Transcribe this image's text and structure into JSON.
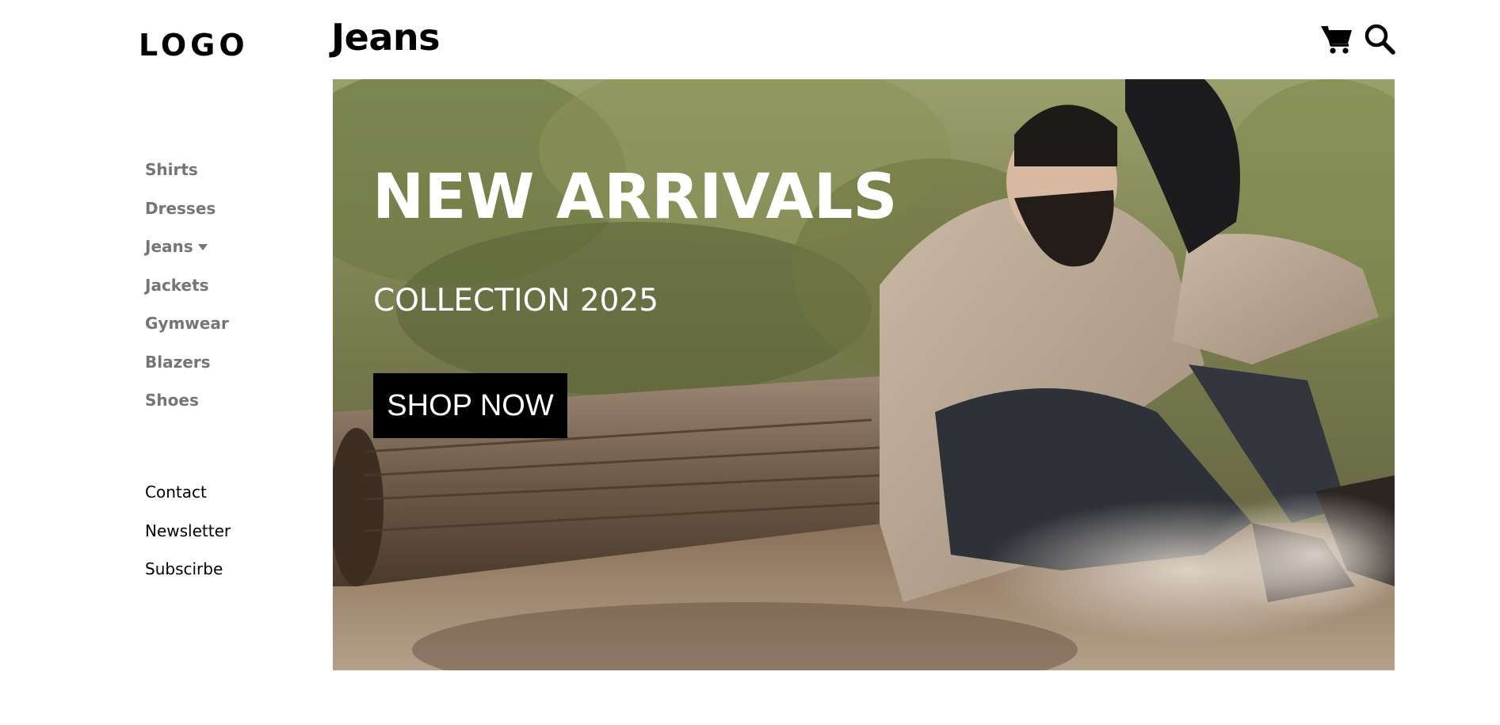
{
  "brand": {
    "logo_text": "LOGO"
  },
  "sidebar": {
    "primary_items": [
      {
        "label": "Shirts"
      },
      {
        "label": "Dresses"
      },
      {
        "label": "Jeans",
        "icon": "caret-down-icon"
      },
      {
        "label": "Jackets"
      },
      {
        "label": "Gymwear"
      },
      {
        "label": "Blazers"
      },
      {
        "label": "Shoes"
      }
    ],
    "secondary_items": [
      {
        "label": "Contact"
      },
      {
        "label": "Newsletter"
      },
      {
        "label": "Subscirbe"
      }
    ]
  },
  "header": {
    "title": "Jeans",
    "icons": [
      "shopping-cart-icon",
      "search-icon"
    ]
  },
  "hero": {
    "title": "NEW ARRIVALS",
    "subtitle": "COLLECTION 2025",
    "button_label": "SHOP NOW",
    "image_subject": "bearded-man-sitting-on-log"
  },
  "colors": {
    "nav_text": "#757575",
    "button_bg": "#000000",
    "button_text": "#ffffff",
    "hero_text": "#ffffff"
  }
}
